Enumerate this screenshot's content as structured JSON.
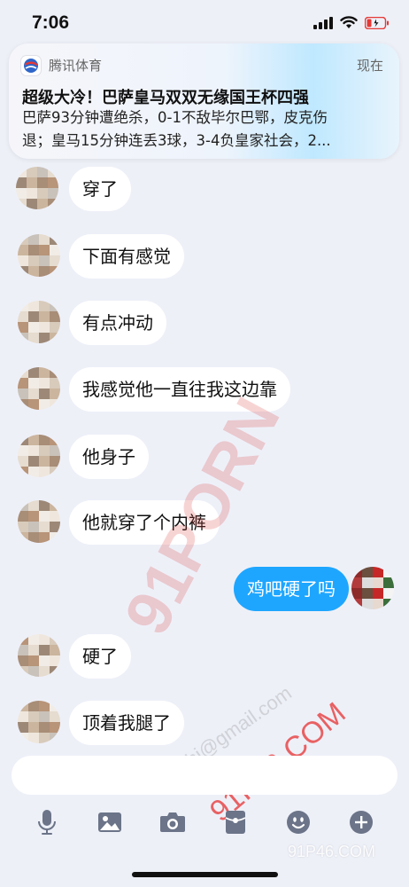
{
  "status_bar": {
    "time": "7:06",
    "battery_color": "#e53935"
  },
  "notification": {
    "app_name": "腾讯体育",
    "time": "现在",
    "title": "超级大冷！巴萨皇马双双无缘国王杯四强",
    "body_line1": "巴萨93分钟遭绝杀，0-1不敌毕尔巴鄂，皮克伤",
    "body_line2": "退；皇马15分钟连丢3球，3-4负皇家社会，2..."
  },
  "messages": [
    {
      "sender": "other",
      "text": "穿了"
    },
    {
      "sender": "other",
      "text": "下面有感觉"
    },
    {
      "sender": "other",
      "text": "有点冲动"
    },
    {
      "sender": "other",
      "text": "我感觉他一直往我这边靠"
    },
    {
      "sender": "other",
      "text": "他身子"
    },
    {
      "sender": "other",
      "text": "他就穿了个内裤"
    },
    {
      "sender": "me",
      "text": "鸡吧硬了吗"
    },
    {
      "sender": "other",
      "text": "硬了"
    },
    {
      "sender": "other",
      "text": "顶着我腿了"
    }
  ],
  "toolbar": {
    "icons": [
      "microphone-icon",
      "image-icon",
      "camera-icon",
      "red-packet-icon",
      "emoji-icon",
      "plus-icon"
    ]
  },
  "watermarks": {
    "w1": "91PORN",
    "w2": "91ruzhi@gmail.com",
    "w3": "91P46.COM",
    "w4": "91P46.COM"
  },
  "colors": {
    "bubble_me": "#1ea6ff",
    "bubble_other": "#ffffff",
    "background": "#eef0f8"
  }
}
